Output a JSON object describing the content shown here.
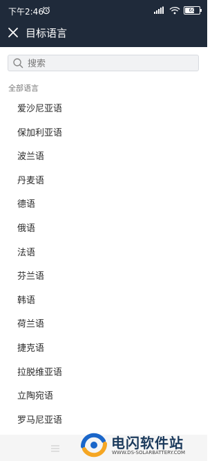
{
  "status_bar": {
    "time": "下午2:46",
    "battery_level": 0.6,
    "battery_text": "60",
    "icons": [
      "alarm-icon",
      "signal-icon",
      "wifi-icon",
      "battery-icon"
    ]
  },
  "nav": {
    "title": "目标语言",
    "close_icon": "close-icon"
  },
  "search": {
    "placeholder": "搜索",
    "value": ""
  },
  "section": {
    "label": "全部语言"
  },
  "languages": [
    "爱沙尼亚语",
    "保加利亚语",
    "波兰语",
    "丹麦语",
    "德语",
    "俄语",
    "法语",
    "芬兰语",
    "韩语",
    "荷兰语",
    "捷克语",
    "拉脱维亚语",
    "立陶宛语",
    "罗马尼亚语"
  ],
  "watermark": {
    "text": "电闪软件站",
    "url": "WWW.DS-SOLARBATTERY.COM"
  },
  "colors": {
    "header_bg": "#1f2a3a",
    "watermark_blue": "#1a66c9",
    "watermark_orange": "#f5a623"
  }
}
